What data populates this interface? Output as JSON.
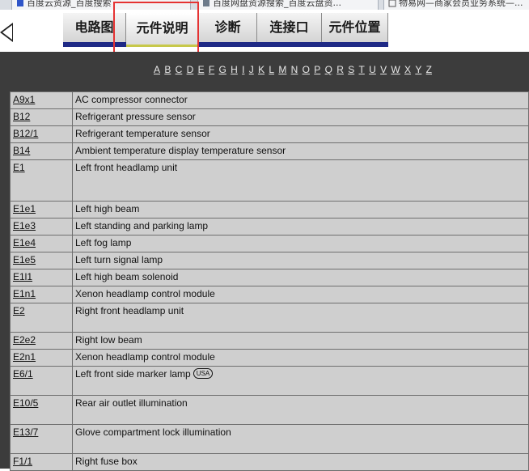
{
  "browser_tabs": [
    {
      "label": "百度云资源_百度搜索"
    },
    {
      "label": "百度网盘资源搜索_百度云盘资..."
    },
    {
      "label": "物易网—商家会员业务系统—..."
    }
  ],
  "toolbar": {
    "tabs": [
      {
        "label": "电路图"
      },
      {
        "label": "元件说明"
      },
      {
        "label": "诊断"
      },
      {
        "label": "连接口"
      },
      {
        "label": "元件位置"
      }
    ]
  },
  "alphabet": [
    "A",
    "B",
    "C",
    "D",
    "E",
    "F",
    "G",
    "H",
    "I",
    "J",
    "K",
    "L",
    "M",
    "N",
    "O",
    "P",
    "Q",
    "R",
    "S",
    "T",
    "U",
    "V",
    "W",
    "X",
    "Y",
    "Z"
  ],
  "parts": [
    {
      "code": "A9x1",
      "desc": "AC compressor connector"
    },
    {
      "code": "B12",
      "desc": "Refrigerant pressure sensor"
    },
    {
      "code": "B12/1",
      "desc": "Refrigerant temperature sensor"
    },
    {
      "code": "B14",
      "desc": "Ambient temperature display temperature sensor"
    },
    {
      "code": "E1",
      "desc": "Left front headlamp unit"
    },
    {
      "code": "E1e1",
      "desc": "Left high beam"
    },
    {
      "code": "E1e3",
      "desc": "Left standing and parking lamp"
    },
    {
      "code": "E1e4",
      "desc": "Left fog lamp"
    },
    {
      "code": "E1e5",
      "desc": "Left turn signal lamp"
    },
    {
      "code": "E1l1",
      "desc": "Left high beam solenoid"
    },
    {
      "code": "E1n1",
      "desc": "Xenon headlamp control module"
    },
    {
      "code": "E2",
      "desc": "Right front headlamp unit"
    },
    {
      "code": "E2e2",
      "desc": "Right low beam"
    },
    {
      "code": "E2n1",
      "desc": "Xenon headlamp control module"
    },
    {
      "code": "E6/1",
      "desc": "Left front side marker lamp",
      "badge": "USA"
    },
    {
      "code": "E10/5",
      "desc": "Rear air outlet illumination"
    },
    {
      "code": "E13/7",
      "desc": "Glove compartment lock illumination"
    },
    {
      "code": "F1/1",
      "desc": "Right fuse box"
    }
  ]
}
